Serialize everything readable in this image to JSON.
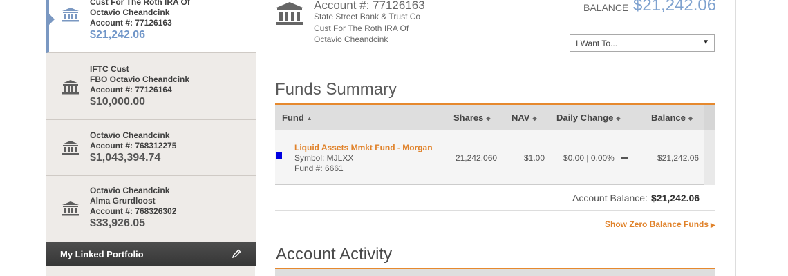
{
  "sidebar": {
    "accounts": [
      {
        "lines": [
          "Cust For The Roth IRA Of",
          "Octavio Cheandcink",
          "Account #: 77126163"
        ],
        "balance": "$21,242.06",
        "active": true
      },
      {
        "lines": [
          "IFTC Cust",
          "FBO Octavio Cheandcink",
          "Account #: 77126164"
        ],
        "balance": "$10,000.00",
        "active": false
      },
      {
        "lines": [
          "Octavio Cheandcink",
          "Account #: 768312275"
        ],
        "balance": "$1,043,394.74",
        "active": false
      },
      {
        "lines": [
          "Octavio Cheandcink",
          "Alma Grurdloost",
          "Account #: 768326302"
        ],
        "balance": "$33,926.05",
        "active": false
      }
    ],
    "linked_portfolio": {
      "label": "My Linked Portfolio",
      "icon": "pencil-icon"
    }
  },
  "header": {
    "account_number": "Account #: 77126163",
    "lines": [
      "State Street Bank & Trust Co",
      "Cust For The Roth IRA Of",
      "Octavio Cheandcink"
    ],
    "balance_label": "BALANCE",
    "balance_value": "$21,242.06",
    "icon": "bank-icon"
  },
  "actions": {
    "i_want_to": "I Want To..."
  },
  "funds_summary": {
    "title": "Funds Summary",
    "columns": {
      "fund": "Fund",
      "shares": "Shares",
      "nav": "NAV",
      "daily_change": "Daily Change",
      "balance": "Balance"
    },
    "rows": [
      {
        "name": "Liquid Assets Mmkt Fund - Morgan",
        "symbol": "Symbol: MJLXX",
        "fund_number": "Fund #: 6661",
        "shares": "21,242.060",
        "nav": "$1.00",
        "daily_change": "$0.00 | 0.00%",
        "balance": "$21,242.06",
        "color": "#0000e0"
      }
    ],
    "account_balance_label": "Account Balance:",
    "account_balance_value": "$21,242.06",
    "show_zero_link": "Show Zero Balance Funds"
  },
  "account_activity": {
    "title": "Account Activity"
  },
  "colors": {
    "accent_orange": "#e0822a",
    "accent_blue": "#7fa2cf",
    "dark_bar": "#3f3f3f"
  }
}
